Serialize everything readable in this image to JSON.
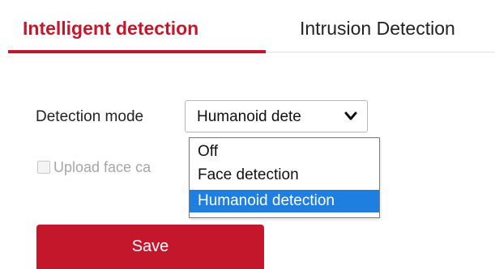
{
  "tabs": [
    {
      "label": "Intelligent detection",
      "active": true
    },
    {
      "label": "Intrusion Detection",
      "active": false
    }
  ],
  "form": {
    "detection_mode_label": "Detection mode",
    "detection_mode_value": "Humanoid dete",
    "upload_face_label": "Upload face ca",
    "upload_face_checked": false,
    "upload_face_disabled": true
  },
  "dropdown": {
    "open": true,
    "selected_index": 2,
    "options": [
      "Off",
      "Face detection",
      "Humanoid detection"
    ]
  },
  "buttons": {
    "save_label": "Save"
  },
  "icons": {
    "select_arrow": "chevron-down-icon"
  },
  "colors": {
    "accent": "#c4172c",
    "selected_option": "#1e7fe0",
    "disabled_text": "#a6a6a6"
  }
}
